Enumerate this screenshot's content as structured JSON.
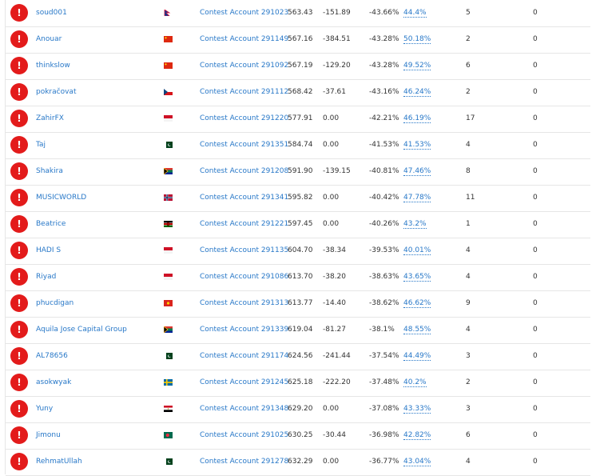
{
  "status_icon": "!",
  "colors": {
    "link": "#2878c8",
    "status": "#e31b1b"
  },
  "rows": [
    {
      "name": "soud001",
      "flag": "np",
      "account": "Contest Account 291023",
      "equity": "563.43",
      "profit": "-151.89",
      "pct": "-43.66%",
      "gain": "44.4%",
      "trades": "5",
      "zero": "0"
    },
    {
      "name": "Anouar",
      "flag": "cn",
      "account": "Contest Account 291149",
      "equity": "567.16",
      "profit": "-384.51",
      "pct": "-43.28%",
      "gain": "50.18%",
      "trades": "2",
      "zero": "0"
    },
    {
      "name": "thinkslow",
      "flag": "cn",
      "account": "Contest Account 291092",
      "equity": "567.19",
      "profit": "-129.20",
      "pct": "-43.28%",
      "gain": "49.52%",
      "trades": "6",
      "zero": "0"
    },
    {
      "name": "pokračovat",
      "flag": "cz",
      "account": "Contest Account 291112",
      "equity": "568.42",
      "profit": "-37.61",
      "pct": "-43.16%",
      "gain": "46.24%",
      "trades": "2",
      "zero": "0"
    },
    {
      "name": "ZahirFX",
      "flag": "id",
      "account": "Contest Account 291220",
      "equity": "577.91",
      "profit": "0.00",
      "pct": "-42.21%",
      "gain": "46.19%",
      "trades": "17",
      "zero": "0"
    },
    {
      "name": "Taj",
      "flag": "pk",
      "account": "Contest Account 291351",
      "equity": "584.74",
      "profit": "0.00",
      "pct": "-41.53%",
      "gain": "41.53%",
      "trades": "4",
      "zero": "0"
    },
    {
      "name": "Shakira",
      "flag": "za",
      "account": "Contest Account 291208",
      "equity": "591.90",
      "profit": "-139.15",
      "pct": "-40.81%",
      "gain": "47.46%",
      "trades": "8",
      "zero": "0"
    },
    {
      "name": "MUSICWORLD",
      "flag": "no",
      "account": "Contest Account 291341",
      "equity": "595.82",
      "profit": "0.00",
      "pct": "-40.42%",
      "gain": "47.78%",
      "trades": "11",
      "zero": "0"
    },
    {
      "name": "Beatrice",
      "flag": "ke",
      "account": "Contest Account 291221",
      "equity": "597.45",
      "profit": "0.00",
      "pct": "-40.26%",
      "gain": "43.2%",
      "trades": "1",
      "zero": "0"
    },
    {
      "name": "HADI S",
      "flag": "id",
      "account": "Contest Account 291135",
      "equity": "604.70",
      "profit": "-38.34",
      "pct": "-39.53%",
      "gain": "40.01%",
      "trades": "4",
      "zero": "0"
    },
    {
      "name": "Riyad",
      "flag": "id",
      "account": "Contest Account 291086",
      "equity": "613.70",
      "profit": "-38.20",
      "pct": "-38.63%",
      "gain": "43.65%",
      "trades": "4",
      "zero": "0"
    },
    {
      "name": "phucdigan",
      "flag": "vn",
      "account": "Contest Account 291313",
      "equity": "613.77",
      "profit": "-14.40",
      "pct": "-38.62%",
      "gain": "46.62%",
      "trades": "9",
      "zero": "0"
    },
    {
      "name": "Aquila Jose Capital Group",
      "flag": "za",
      "account": "Contest Account 291339",
      "equity": "619.04",
      "profit": "-81.27",
      "pct": "-38.1%",
      "gain": "48.55%",
      "trades": "4",
      "zero": "0"
    },
    {
      "name": "AL78656",
      "flag": "pk",
      "account": "Contest Account 291174",
      "equity": "624.56",
      "profit": "-241.44",
      "pct": "-37.54%",
      "gain": "44.49%",
      "trades": "3",
      "zero": "0"
    },
    {
      "name": "asokwyak",
      "flag": "se",
      "account": "Contest Account 291245",
      "equity": "625.18",
      "profit": "-222.20",
      "pct": "-37.48%",
      "gain": "40.2%",
      "trades": "2",
      "zero": "0"
    },
    {
      "name": "Yuny",
      "flag": "eg",
      "account": "Contest Account 291348",
      "equity": "629.20",
      "profit": "0.00",
      "pct": "-37.08%",
      "gain": "43.33%",
      "trades": "3",
      "zero": "0"
    },
    {
      "name": "Jimonu",
      "flag": "bd",
      "account": "Contest Account 291025",
      "equity": "630.25",
      "profit": "-30.44",
      "pct": "-36.98%",
      "gain": "42.82%",
      "trades": "6",
      "zero": "0"
    },
    {
      "name": "RehmatUllah",
      "flag": "pk",
      "account": "Contest Account 291278",
      "equity": "632.29",
      "profit": "0.00",
      "pct": "-36.77%",
      "gain": "43.04%",
      "trades": "4",
      "zero": "0"
    }
  ]
}
